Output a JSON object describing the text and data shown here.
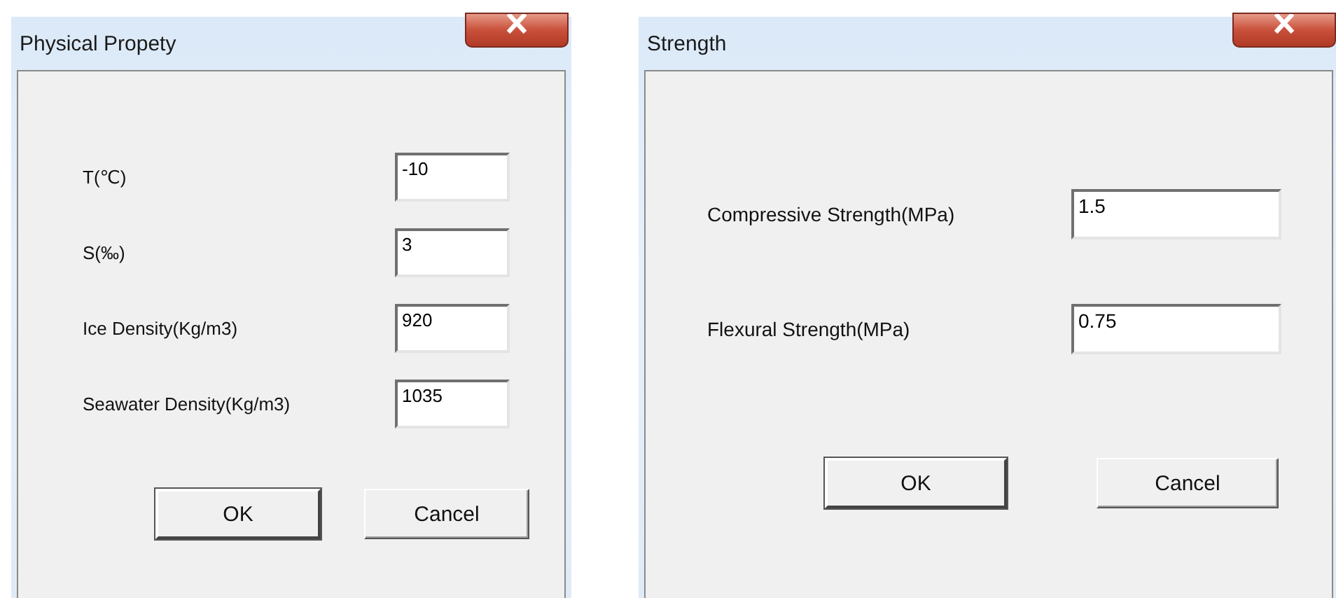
{
  "dialogs": [
    {
      "title": "Physical Propety",
      "fields": [
        {
          "label": "T(℃)",
          "value": "-10"
        },
        {
          "label": "S(‰)",
          "value": "3"
        },
        {
          "label": "Ice Density(Kg/m3)",
          "value": "920"
        },
        {
          "label": "Seawater Density(Kg/m3)",
          "value": "1035"
        }
      ],
      "buttons": [
        {
          "label": "OK",
          "kind": "default"
        },
        {
          "label": "Cancel",
          "kind": "normal"
        }
      ]
    },
    {
      "title": "Strength",
      "fields": [
        {
          "label": "Compressive Strength(MPa)",
          "value": "1.5"
        },
        {
          "label": "Flexural Strength(MPa)",
          "value": "0.75"
        }
      ],
      "buttons": [
        {
          "label": "OK",
          "kind": "default"
        },
        {
          "label": "Cancel",
          "kind": "normal"
        }
      ]
    }
  ]
}
